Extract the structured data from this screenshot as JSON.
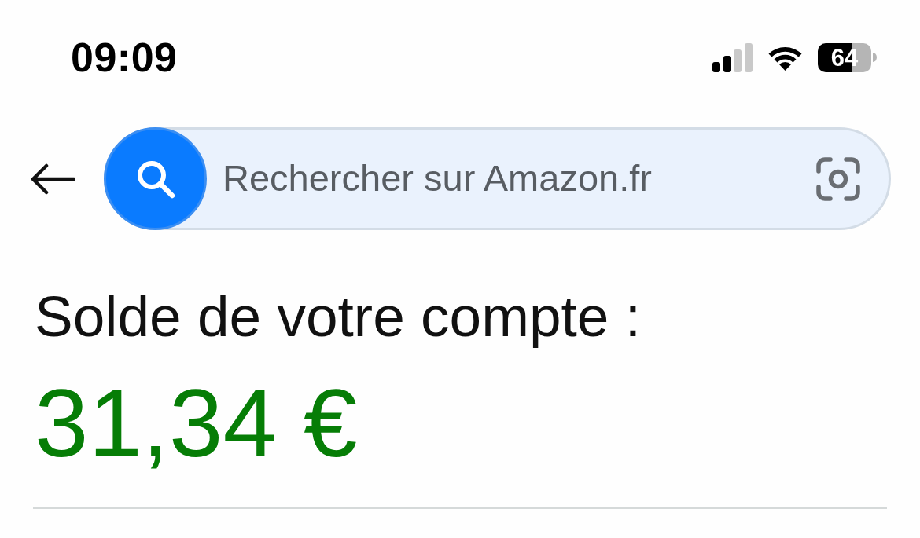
{
  "status_bar": {
    "time": "09:09",
    "battery": "64"
  },
  "search": {
    "placeholder": "Rechercher sur Amazon.fr"
  },
  "balance": {
    "label": "Solde de votre compte :",
    "amount": "31,34 €"
  }
}
